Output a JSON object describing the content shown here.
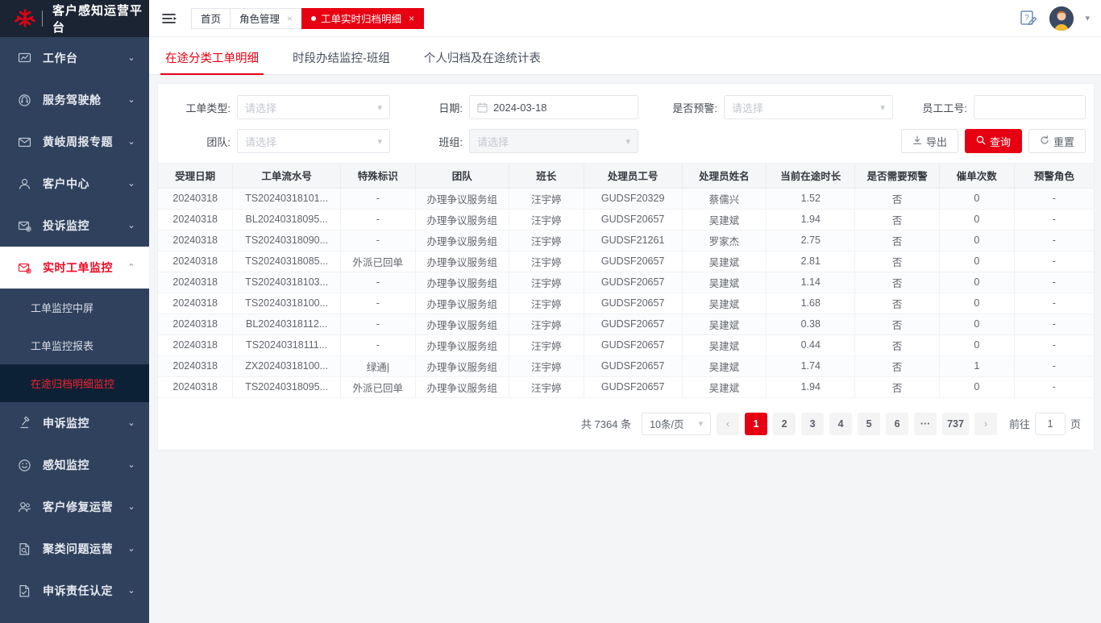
{
  "brand": {
    "title": "客户感知运营平台",
    "logo_icon": "china-unicom-logo"
  },
  "sidebar": {
    "items": [
      {
        "label": "工作台",
        "icon": "monitor-chart-icon",
        "chevron": "chevron-down",
        "active": false
      },
      {
        "label": "服务驾驶舱",
        "icon": "headset-icon",
        "chevron": "chevron-down",
        "active": false
      },
      {
        "label": "黄岐周报专题",
        "icon": "mail-icon",
        "chevron": "chevron-down",
        "active": false
      },
      {
        "label": "客户中心",
        "icon": "users-icon",
        "chevron": "chevron-down",
        "active": false
      },
      {
        "label": "投诉监控",
        "icon": "mail-alert-icon",
        "chevron": "chevron-down",
        "active": false
      },
      {
        "label": "实时工单监控",
        "icon": "mail-monitor-icon",
        "chevron": "chevron-up",
        "active": true
      },
      {
        "label": "申诉监控",
        "icon": "gavel-icon",
        "chevron": "chevron-down",
        "active": false
      },
      {
        "label": "感知监控",
        "icon": "smile-clock-icon",
        "chevron": "chevron-down",
        "active": false
      },
      {
        "label": "客户修复运营",
        "icon": "user-group-icon",
        "chevron": "chevron-down",
        "active": false
      },
      {
        "label": "聚类问题运营",
        "icon": "file-search-icon",
        "chevron": "chevron-down",
        "active": false
      },
      {
        "label": "申诉责任认定",
        "icon": "file-check-icon",
        "chevron": "chevron-down",
        "active": false
      }
    ],
    "sub_items": [
      {
        "label": "工单监控中屏",
        "active": false
      },
      {
        "label": "工单监控报表",
        "active": false
      },
      {
        "label": "在途归档明细监控",
        "active": true
      }
    ]
  },
  "topbar": {
    "hamburger_icon": "menu-collapse-icon",
    "help_icon": "help-edit-icon",
    "avatar_icon": "user-avatar",
    "caret_icon": "chevron-down-icon",
    "window_tabs": [
      {
        "label": "首页",
        "closable": false,
        "active": false
      },
      {
        "label": "角色管理",
        "closable": true,
        "active": false
      },
      {
        "label": "工单实时归档明细",
        "closable": true,
        "active": true
      }
    ]
  },
  "page_tabs": [
    {
      "label": "在途分类工单明细",
      "active": true
    },
    {
      "label": "时段办结监控-班组",
      "active": false
    },
    {
      "label": "个人归档及在途统计表",
      "active": false
    }
  ],
  "filters": {
    "work_order_type": {
      "label": "工单类型:",
      "value": "请选择",
      "placeholder": "请选择",
      "is_placeholder": true
    },
    "date": {
      "label": "日期:",
      "value": "2024-03-18",
      "icon": "calendar-icon",
      "is_placeholder": false
    },
    "is_warning": {
      "label": "是否预警:",
      "value": "请选择",
      "placeholder": "请选择",
      "is_placeholder": true
    },
    "employee_id": {
      "label": "员工工号:",
      "value": "",
      "placeholder": ""
    },
    "team": {
      "label": "团队:",
      "value": "请选择",
      "placeholder": "请选择",
      "is_placeholder": true
    },
    "shift": {
      "label": "班组:",
      "value": "请选择",
      "placeholder": "请选择",
      "is_placeholder": true
    },
    "buttons": {
      "export": {
        "label": "导出",
        "icon": "download-icon"
      },
      "query": {
        "label": "查询",
        "icon": "search-icon"
      },
      "reset": {
        "label": "重置",
        "icon": "refresh-icon"
      }
    }
  },
  "table": {
    "columns": [
      "受理日期",
      "工单流水号",
      "特殊标识",
      "团队",
      "班长",
      "处理员工号",
      "处理员姓名",
      "当前在途时长",
      "是否需要预警",
      "催单次数",
      "预警角色"
    ],
    "rows": [
      [
        "20240318",
        "TS20240318101...",
        "-",
        "办理争议服务组",
        "汪宇婷",
        "GUDSF20329",
        "蔡儒兴",
        "1.52",
        "否",
        "0",
        "-"
      ],
      [
        "20240318",
        "BL20240318095...",
        "-",
        "办理争议服务组",
        "汪宇婷",
        "GUDSF20657",
        "吴建斌",
        "1.94",
        "否",
        "0",
        "-"
      ],
      [
        "20240318",
        "TS20240318090...",
        "-",
        "办理争议服务组",
        "汪宇婷",
        "GUDSF21261",
        "罗家杰",
        "2.75",
        "否",
        "0",
        "-"
      ],
      [
        "20240318",
        "TS20240318085...",
        "外派已回单",
        "办理争议服务组",
        "汪宇婷",
        "GUDSF20657",
        "吴建斌",
        "2.81",
        "否",
        "0",
        "-"
      ],
      [
        "20240318",
        "TS20240318103...",
        "-",
        "办理争议服务组",
        "汪宇婷",
        "GUDSF20657",
        "吴建斌",
        "1.14",
        "否",
        "0",
        "-"
      ],
      [
        "20240318",
        "TS20240318100...",
        "-",
        "办理争议服务组",
        "汪宇婷",
        "GUDSF20657",
        "吴建斌",
        "1.68",
        "否",
        "0",
        "-"
      ],
      [
        "20240318",
        "BL20240318112...",
        "-",
        "办理争议服务组",
        "汪宇婷",
        "GUDSF20657",
        "吴建斌",
        "0.38",
        "否",
        "0",
        "-"
      ],
      [
        "20240318",
        "TS20240318111...",
        "-",
        "办理争议服务组",
        "汪宇婷",
        "GUDSF20657",
        "吴建斌",
        "0.44",
        "否",
        "0",
        "-"
      ],
      [
        "20240318",
        "ZX20240318100...",
        "绿通|",
        "办理争议服务组",
        "汪宇婷",
        "GUDSF20657",
        "吴建斌",
        "1.74",
        "否",
        "1",
        "-"
      ],
      [
        "20240318",
        "TS20240318095...",
        "外派已回单",
        "办理争议服务组",
        "汪宇婷",
        "GUDSF20657",
        "吴建斌",
        "1.94",
        "否",
        "0",
        "-"
      ]
    ]
  },
  "pagination": {
    "total_text": "共 7364 条",
    "page_size": "10条/页",
    "prev_icon": "chevron-left-icon",
    "next_icon": "chevron-right-icon",
    "pages": [
      "1",
      "2",
      "3",
      "4",
      "5",
      "6",
      "···",
      "737"
    ],
    "current_page": "1",
    "jump_prefix": "前往",
    "jump_value": "1",
    "jump_suffix": "页"
  },
  "colors": {
    "accent": "#e60012",
    "sidebar_bg": "#30415d",
    "sidebar_brand_bg": "#1b2433",
    "sub_active_bg": "#0c2135",
    "content_bg": "#f4f5f7"
  }
}
